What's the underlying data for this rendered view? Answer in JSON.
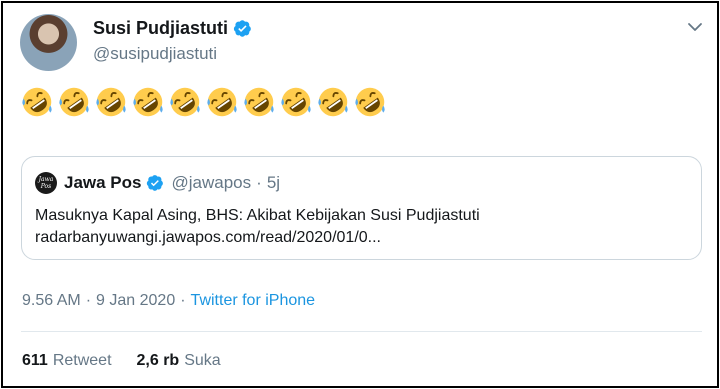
{
  "tweet": {
    "author_name": "Susi Pudjiastuti",
    "author_handle": "@susipudjiastuti",
    "emoji_text": "🤣🤣🤣🤣🤣🤣🤣🤣🤣🤣",
    "emoji_count": 10,
    "emoji_name": "rolling-on-the-floor-laughing",
    "timestamp_time": "9.56 AM",
    "timestamp_sep": "·",
    "timestamp_date": "9 Jan 2020",
    "source": "Twitter for iPhone"
  },
  "quoted": {
    "avatar_text": "Jawa Pos",
    "name": "Jawa Pos",
    "handle": "@jawapos",
    "dot": "·",
    "time": "5j",
    "line1": "Masuknya Kapal Asing, BHS: Akibat Kebijakan Susi Pudjiastuti",
    "line2": "radarbanyuwangi.jawapos.com/read/2020/01/0..."
  },
  "stats": {
    "retweet_count": "611",
    "retweet_label": "Retweet",
    "like_count": "2,6 rb",
    "like_label": "Suka"
  },
  "colors": {
    "verified": "#1da1f2",
    "link": "#1b95e0",
    "secondary_text": "#657786",
    "border": "#ccd6dd"
  },
  "icons": {
    "verified": "verified-badge-icon",
    "menu": "chevron-down-icon",
    "emoji": "rolling-laughing-emoji-icon"
  }
}
